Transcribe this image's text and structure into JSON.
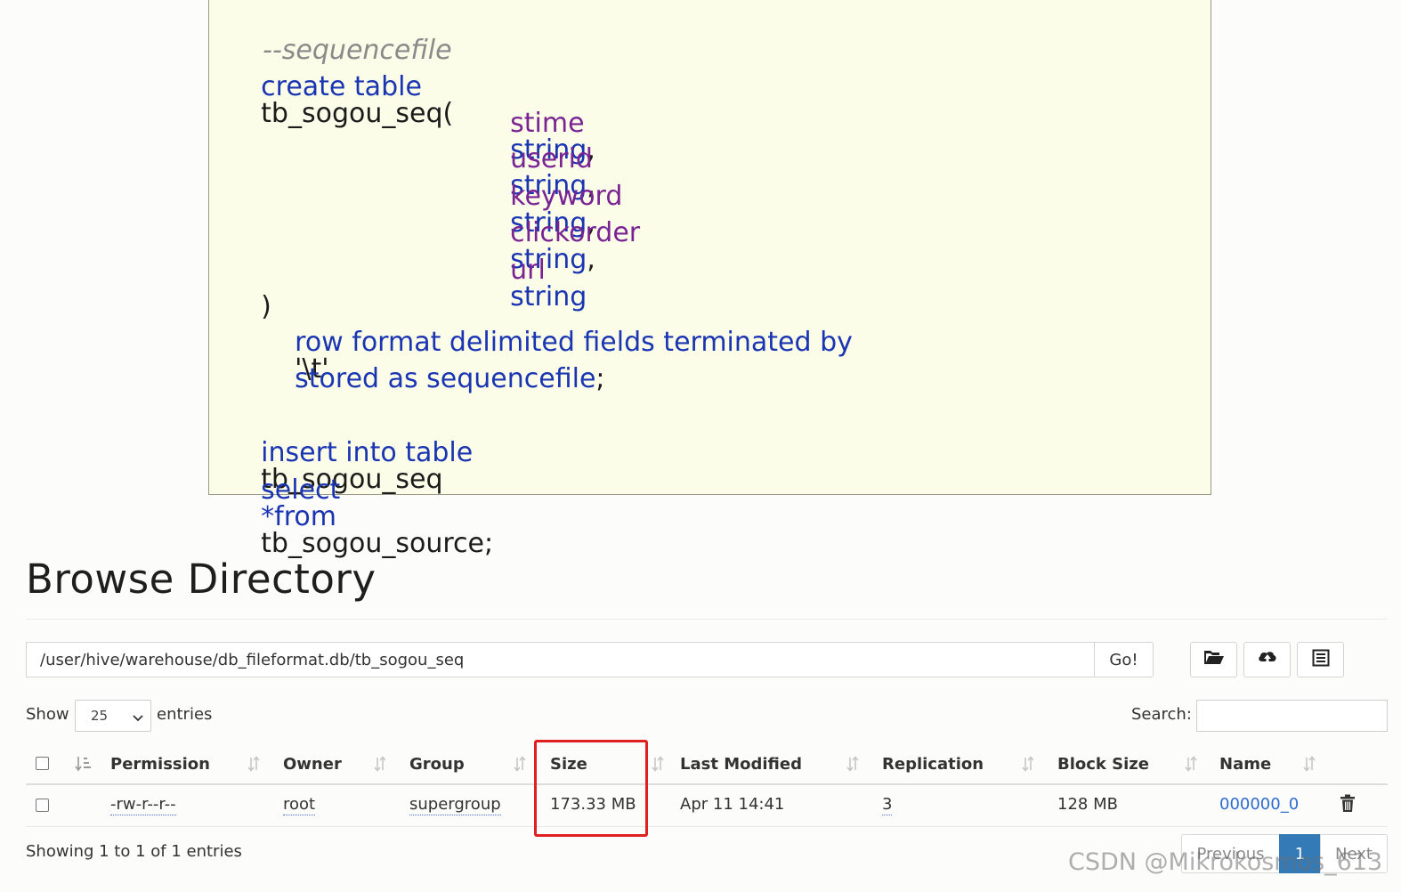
{
  "code": {
    "comment": "--sequencefile",
    "create_kw": "create table",
    "table_name": "tb_sogou_seq(",
    "columns": [
      {
        "name": "stime",
        "type": "string",
        "sep": ","
      },
      {
        "name": "userid",
        "type": "string",
        "sep": ","
      },
      {
        "name": "keyword",
        "type": "string",
        "sep": ","
      },
      {
        "name": "clickorder",
        "type": "string",
        "sep": ","
      },
      {
        "name": "url",
        "type": "string",
        "sep": ""
      }
    ],
    "close_paren": ")",
    "row_format_kw": "row format delimited fields terminated by",
    "delimiter": "'\\t'",
    "stored_kw": "stored as sequencefile",
    "stored_end": ";",
    "insert_kw": "insert into table",
    "insert_table": "tb_sogou_seq",
    "select_kw": "select",
    "star": "*",
    "from_kw": "from",
    "source_table": "tb_sogou_source;"
  },
  "browse": {
    "title": "Browse Directory",
    "path_value": "/user/hive/warehouse/db_fileformat.db/tb_sogou_seq",
    "go_label": "Go!",
    "toolbar_icons": [
      "folder-open-icon",
      "upload-cloud-icon",
      "list-icon"
    ],
    "show_label": "Show",
    "entries_value": "25",
    "entries_label": "entries",
    "search_label": "Search:",
    "search_value": ""
  },
  "table": {
    "headers": [
      "Permission",
      "Owner",
      "Group",
      "Size",
      "Last Modified",
      "Replication",
      "Block Size",
      "Name"
    ],
    "rows": [
      {
        "permission": "-rw-r--r--",
        "owner": "root",
        "group": "supergroup",
        "size": "173.33 MB",
        "last_modified": "Apr 11 14:41",
        "replication": "3",
        "block_size": "128 MB",
        "name": "000000_0"
      }
    ],
    "highlighted_column": "Size",
    "highlight_color": "#e02020"
  },
  "footer": {
    "info": "Showing 1 to 1 of 1 entries",
    "previous_label": "Previous",
    "current_page": "1",
    "next_label": "Next"
  },
  "watermark": "CSDN @Mikrokosmos_613",
  "colors": {
    "keyword": "#1a35b2",
    "identifier": "#7a2393",
    "code_background": "#fcfde8",
    "link": "#2e6bd0",
    "pager_active": "#337ab7"
  }
}
